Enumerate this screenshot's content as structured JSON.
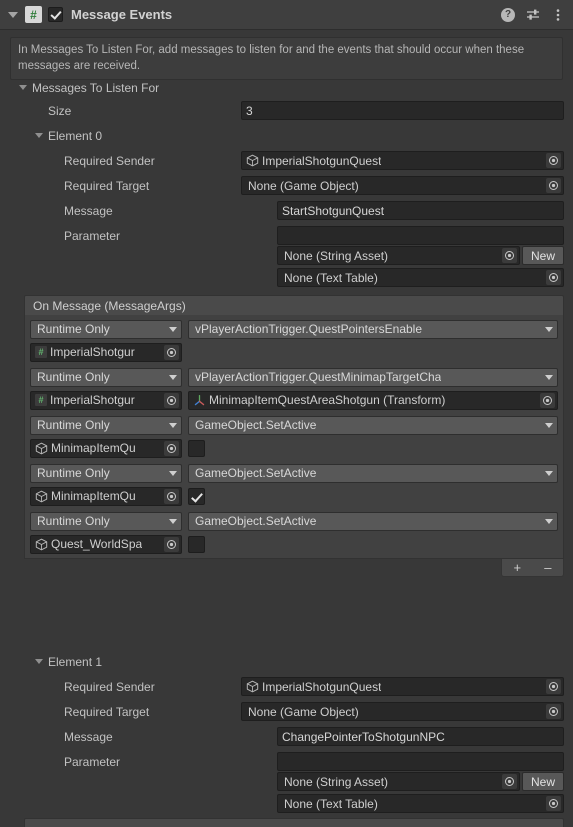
{
  "component": {
    "title": "Message Events",
    "enabled": true,
    "icon": "csharp-script-icon",
    "help_icon": "help-icon",
    "preset_icon": "preset-settings-icon",
    "menu_icon": "kebab-menu-icon",
    "helpbox_text": "In Messages To Listen For, add messages to listen for and the events that should occur when these messages are received."
  },
  "array": {
    "label": "Messages To Listen For",
    "size_label": "Size",
    "size_value": "3"
  },
  "labels": {
    "required_sender": "Required Sender",
    "required_target": "Required Target",
    "message": "Message",
    "parameter": "Parameter",
    "new_button": "New",
    "none_game_object": "None (Game Object)",
    "none_string_asset": "None (String Asset)",
    "none_text_table": "None (Text Table)",
    "plus": "+",
    "minus": "–"
  },
  "elements": [
    {
      "label": "Element 0",
      "required_sender": "ImperialShotgunQuest",
      "required_target": "None (Game Object)",
      "message": "StartShotgunQuest",
      "parameter": "",
      "string_asset": "None (String Asset)",
      "text_table": "None (Text Table)",
      "event_title": "On Message (MessageArgs)",
      "event_entries": [
        {
          "mode": "Runtime Only",
          "function": "vPlayerActionTrigger.QuestPointersEnable",
          "object": "ImperialShotgur",
          "object_icon": "script-icon",
          "arg_type": "none"
        },
        {
          "mode": "Runtime Only",
          "function": "vPlayerActionTrigger.QuestMinimapTargetCha",
          "object": "ImperialShotgur",
          "object_icon": "script-icon",
          "arg_type": "object",
          "arg_value": "MinimapItemQuestAreaShotgun (Transform)",
          "arg_icon": "transform-icon"
        },
        {
          "mode": "Runtime Only",
          "function": "GameObject.SetActive",
          "object": "MinimapItemQu",
          "object_icon": "cube-icon",
          "arg_type": "bool",
          "arg_checked": false
        },
        {
          "mode": "Runtime Only",
          "function": "GameObject.SetActive",
          "object": "MinimapItemQu",
          "object_icon": "cube-icon",
          "arg_type": "bool",
          "arg_checked": true
        },
        {
          "mode": "Runtime Only",
          "function": "GameObject.SetActive",
          "object": "Quest_WorldSpa",
          "object_icon": "cube-icon",
          "arg_type": "bool",
          "arg_checked": false
        }
      ]
    },
    {
      "label": "Element 1",
      "required_sender": "ImperialShotgunQuest",
      "required_target": "None (Game Object)",
      "message": "ChangePointerToShotgunNPC",
      "parameter": "",
      "string_asset": "None (String Asset)",
      "text_table": "None (Text Table)"
    }
  ],
  "colors": {
    "window_bg": "#383838",
    "header_bg": "#3f3f3f",
    "field_bg": "#282828",
    "button_bg": "#585858",
    "event_bg": "#414141",
    "event_title_bg": "#4a4a4a",
    "script_green": "#63b56f"
  }
}
